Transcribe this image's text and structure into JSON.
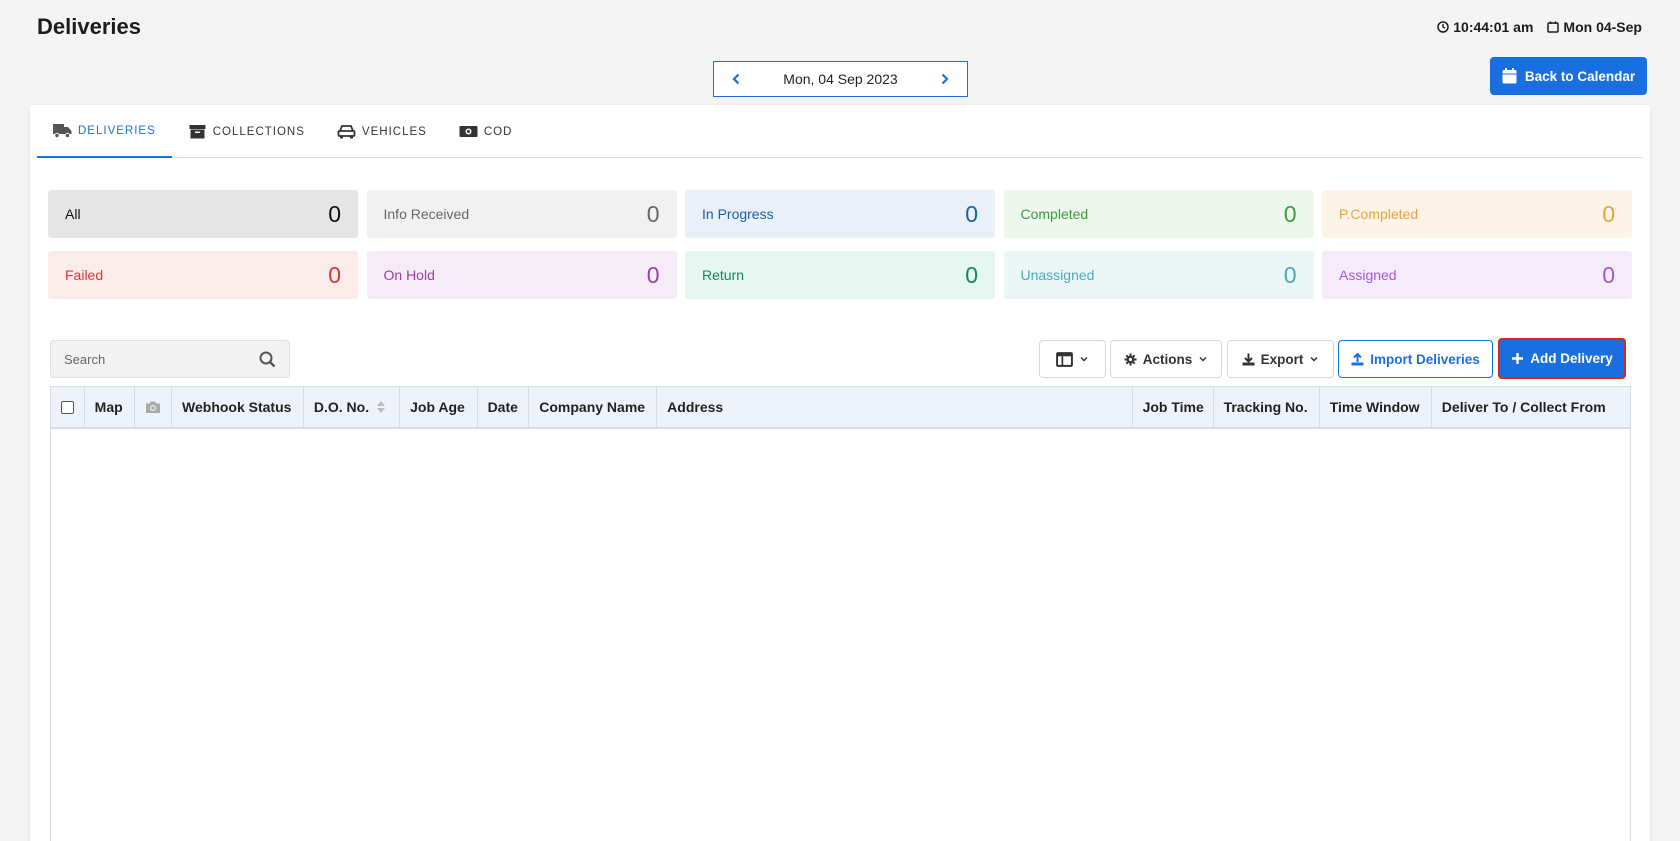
{
  "header": {
    "title": "Deliveries",
    "time": "10:44:01 am",
    "date_short": "Mon 04-Sep"
  },
  "date_nav": {
    "label": "Mon, 04 Sep 2023"
  },
  "back_button": {
    "label": "Back to Calendar"
  },
  "tabs": [
    {
      "label": "DELIVERIES",
      "icon": "truck-icon",
      "active": true
    },
    {
      "label": "COLLECTIONS",
      "icon": "archive-box-icon",
      "active": false
    },
    {
      "label": "VEHICLES",
      "icon": "car-icon",
      "active": false
    },
    {
      "label": "COD",
      "icon": "cash-icon",
      "active": false
    }
  ],
  "stats": [
    {
      "label": "All",
      "count": "0",
      "bg": "#e5e5e5",
      "color": "#111111"
    },
    {
      "label": "Info Received",
      "count": "0",
      "bg": "#f1f1f1",
      "color": "#666666"
    },
    {
      "label": "In Progress",
      "count": "0",
      "bg": "#e9f0f9",
      "color": "#1a5fa8"
    },
    {
      "label": "Completed",
      "count": "0",
      "bg": "#edf7ee",
      "color": "#3a9d3e"
    },
    {
      "label": "P.Completed",
      "count": "0",
      "bg": "#fdf4e9",
      "color": "#f1a03a"
    },
    {
      "label": "Failed",
      "count": "0",
      "bg": "#fcebeb",
      "color": "#d23b36"
    },
    {
      "label": "On Hold",
      "count": "0",
      "bg": "#f6ecf6",
      "color": "#9a3fa5"
    },
    {
      "label": "Return",
      "count": "0",
      "bg": "#e6f6f1",
      "color": "#11875f"
    },
    {
      "label": "Unassigned",
      "count": "0",
      "bg": "#ecf6f7",
      "color": "#4aa8b8"
    },
    {
      "label": "Assigned",
      "count": "0",
      "bg": "#f5ecfa",
      "color": "#a258d6"
    }
  ],
  "search": {
    "placeholder": "Search"
  },
  "toolbar": {
    "actions_label": "Actions",
    "export_label": "Export",
    "import_label": "Import Deliveries",
    "add_label": "Add Delivery"
  },
  "table": {
    "columns": [
      "Map",
      "Webhook Status",
      "D.O. No.",
      "Job Age",
      "Date",
      "Company Name",
      "Address",
      "Job Time",
      "Tracking No.",
      "Time Window",
      "Deliver To / Collect From"
    ]
  },
  "colors": {
    "accent": "#1a6fe0",
    "highlight_border": "#e0241d"
  }
}
